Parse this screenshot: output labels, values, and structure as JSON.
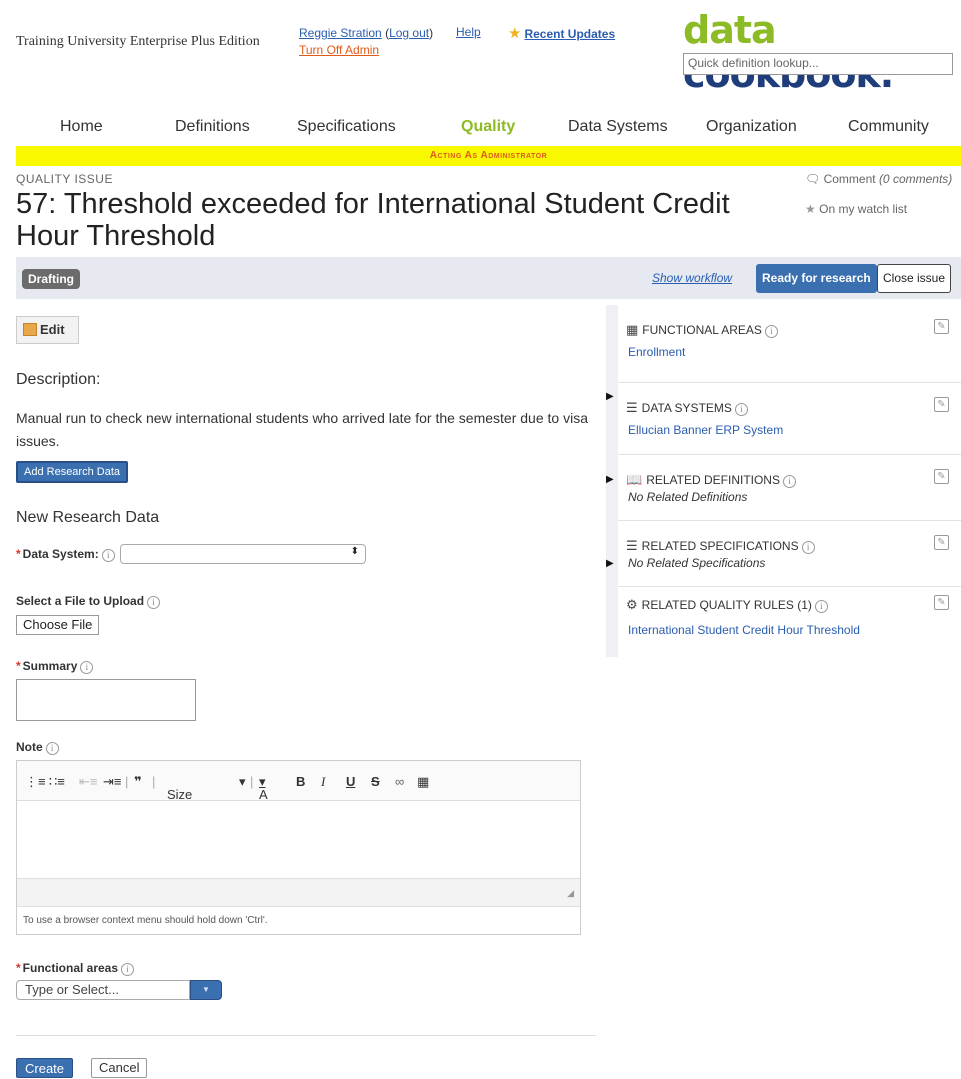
{
  "header": {
    "org_name": "Training University Enterprise Plus Edition",
    "user_name": "Reggie Stration",
    "logout": "Log out",
    "help": "Help",
    "turn_off_admin": "Turn Off Admin",
    "recent_updates": "Recent Updates",
    "logo_part1": "data",
    "logo_part2": "cookbook.",
    "quick_lookup_placeholder": "Quick definition lookup..."
  },
  "nav": {
    "items": [
      "Home",
      "Definitions",
      "Specifications",
      "Quality",
      "Data Systems",
      "Organization",
      "Community"
    ],
    "active": "Quality"
  },
  "admin_banner": "Acting As Administrator",
  "page": {
    "section_label": "QUALITY ISSUE",
    "title": "57: Threshold exceeded for International Student Credit Hour Threshold",
    "comment_label": "Comment",
    "comment_count": "(0 comments)",
    "watch_label": "On my watch list"
  },
  "status_bar": {
    "status": "Drafting",
    "show_workflow": "Show workflow",
    "ready_button": "Ready for research",
    "close_button": "Close issue"
  },
  "main": {
    "edit_button": "Edit",
    "description_heading": "Description:",
    "description_text": "Manual run to check new international students who arrived late for the semester due to visa issues.",
    "add_research_button": "Add Research Data",
    "new_research_heading": "New Research Data",
    "data_system_label": "Data System:",
    "file_label": "Select a File to Upload",
    "choose_file_button": "Choose File",
    "summary_label": "Summary",
    "note_label": "Note",
    "editor_toolbar": {
      "size_label": "Size",
      "bold": "B",
      "italic": "I",
      "underline": "U",
      "strike": "S",
      "font_color": "A"
    },
    "editor_hint": "To use a browser context menu should hold down 'Ctrl'.",
    "functional_areas_label": "Functional areas",
    "functional_areas_placeholder": "Type or Select...",
    "create_button": "Create",
    "cancel_button": "Cancel"
  },
  "right_panel": {
    "sections": [
      {
        "title": "FUNCTIONAL AREAS",
        "value": "Enrollment",
        "icon": "building-icon"
      },
      {
        "title": "DATA SYSTEMS",
        "value": "Ellucian Banner ERP System",
        "icon": "data-system-icon"
      },
      {
        "title": "RELATED DEFINITIONS",
        "value": "No Related Definitions",
        "icon": "book-icon"
      },
      {
        "title": "RELATED SPECIFICATIONS",
        "value": "No Related Specifications",
        "icon": "document-icon"
      },
      {
        "title": "RELATED QUALITY RULES (1)",
        "value": "International Student Credit Hour Threshold",
        "icon": "gear-icon"
      }
    ]
  },
  "colors": {
    "brand_green": "#8dbb25",
    "brand_navy": "#1f3d7a",
    "primary_blue": "#3a6fb0",
    "admin_banner_bg": "#f8f800",
    "admin_text": "#e05a1a"
  }
}
